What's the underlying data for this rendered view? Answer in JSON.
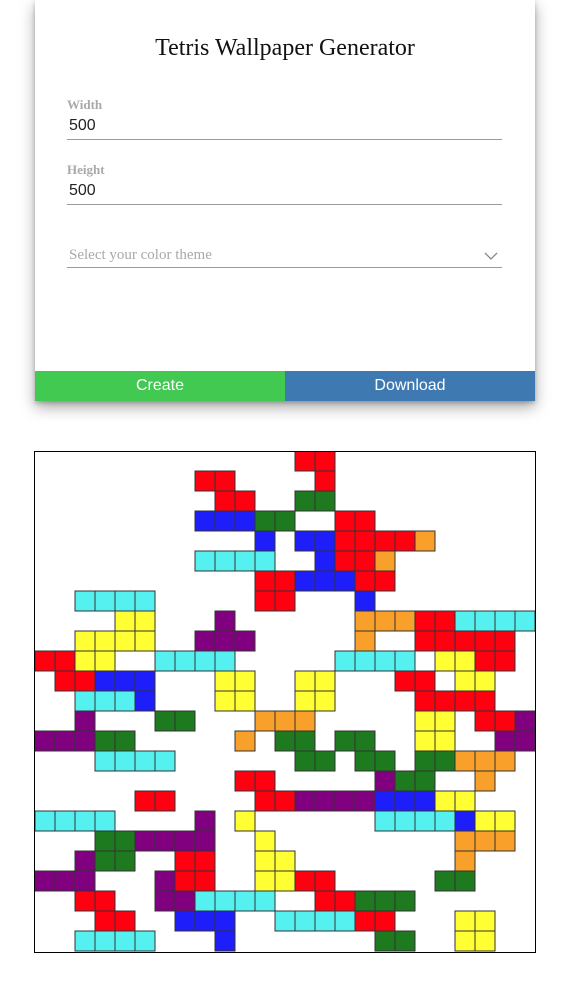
{
  "app": {
    "title": "Tetris Wallpaper Generator"
  },
  "form": {
    "width": {
      "label": "Width",
      "value": "500"
    },
    "height": {
      "label": "Height",
      "value": "500"
    },
    "theme": {
      "placeholder": "Select your color theme"
    }
  },
  "buttons": {
    "create_label": "Create",
    "download_label": "Download"
  },
  "colors": {
    "create_button": "#41c952",
    "download_button": "#3e79b2",
    "block_red": "#ff0010",
    "block_blue": "#1e1efa",
    "block_green": "#1e7a1e",
    "block_cyan": "#55f0f0",
    "block_yellow": "#ffff33",
    "block_purple": "#800080",
    "block_orange": "#f9a02a"
  },
  "icons": {
    "theme_dropdown": "chevron-down-icon"
  }
}
